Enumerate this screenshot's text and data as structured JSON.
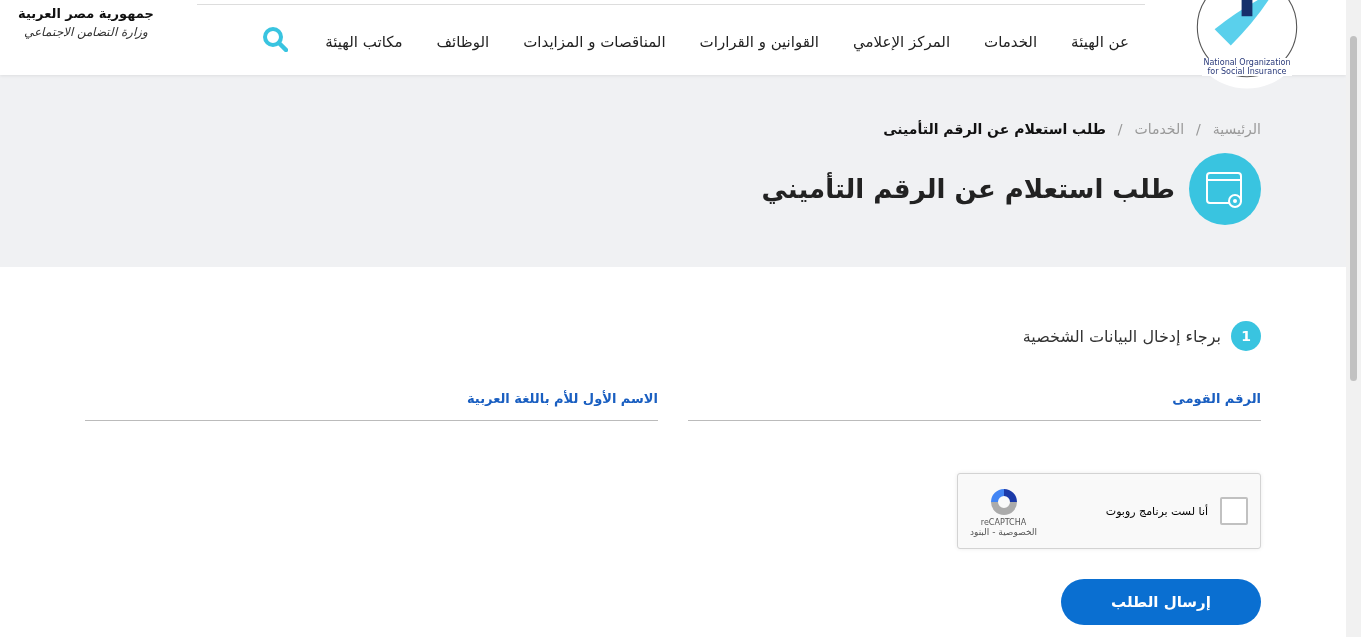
{
  "header": {
    "ministry": {
      "line_1": "جمهورية مصر العربية",
      "line_2": "وزارة التضامن الاجتماعي"
    },
    "logo_text": "National Organization for Social Insurance",
    "nav": [
      "عن الهيئة",
      "الخدمات",
      "المركز الإعلامي",
      "القوانين و القرارات",
      "المناقصات و المزايدات",
      "الوظائف",
      "مكاتب الهيئة"
    ]
  },
  "breadcrumb_separator": "/",
  "breadcrumb": [
    {
      "label": "الرئيسية",
      "current": false
    },
    {
      "label": "الخدمات",
      "current": false
    },
    {
      "label": "طلب استعلام عن الرقم التأمينى",
      "current": true
    }
  ],
  "page_title": "طلب استعلام عن الرقم التأميني",
  "step": {
    "number": "1",
    "title": "برجاء إدخال البيانات الشخصية"
  },
  "fields": [
    {
      "label": "الرقم القومى"
    },
    {
      "label": "الاسم الأول للأم باللغة العربية"
    }
  ],
  "captcha": {
    "label": "أنا لست برنامج روبوت",
    "checked": false,
    "brand": "reCAPTCHA",
    "links": "الخصوصية - البنود"
  },
  "submit": "إرسال الطلب"
}
